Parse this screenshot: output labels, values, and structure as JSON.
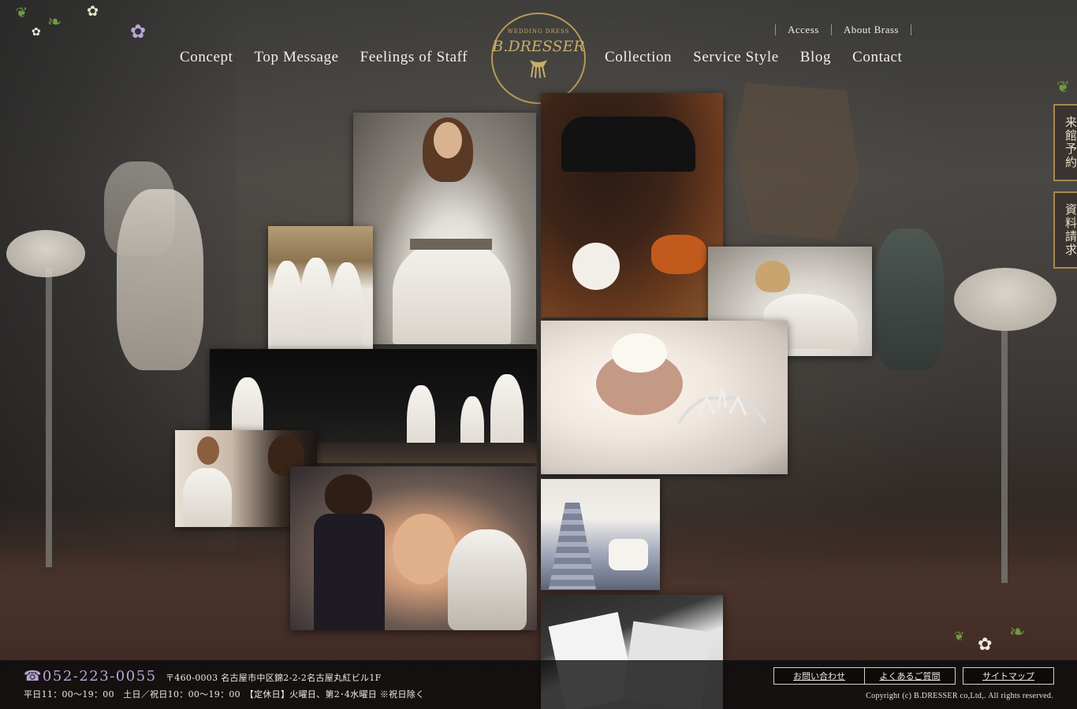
{
  "header": {
    "logo": {
      "small_text": "WEDDING DRESS",
      "brand": "B.DRESSER"
    },
    "nav_left": [
      "Concept",
      "Top Message",
      "Feelings of Staff"
    ],
    "nav_right": [
      "Collection",
      "Service Style",
      "Blog",
      "Contact"
    ],
    "subnav": [
      "Access",
      "About Brass"
    ]
  },
  "side_tabs": [
    "来館予約",
    "資料請求"
  ],
  "footer": {
    "phone": "☎052-223-0055",
    "address": "〒460-0003 名古屋市中区錦2-2-2名古屋丸紅ビル1F",
    "hours": "平日11：00〜19：00　土日／祝日10：00〜19：00　【定休日】火曜日、第2･4水曜日 ※祝日除く",
    "buttons": [
      "お問い合わせ",
      "よくあるご質問",
      "サイトマップ"
    ],
    "copyright": "Copyright (c) B.DRESSER co,Ltd,. All rights reserved."
  },
  "colors": {
    "accent_gold": "#b49a5a",
    "phone_purple": "#b9a3d6"
  }
}
